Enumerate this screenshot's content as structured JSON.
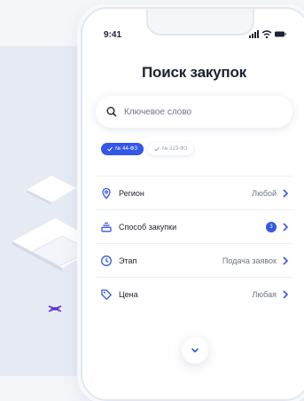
{
  "status_bar": {
    "time": "9:41"
  },
  "page_title": "Поиск закупок",
  "search": {
    "placeholder": "Ключевое слово",
    "value": ""
  },
  "chips": [
    {
      "label": "№ 44-ФЗ",
      "active": true
    },
    {
      "label": "№ 223-ФЗ",
      "active": false
    }
  ],
  "filters": [
    {
      "label": "Регион",
      "value": "Любой",
      "icon": "location-pin-icon"
    },
    {
      "label": "Способ закупки",
      "badge": "3",
      "icon": "stack-icon"
    },
    {
      "label": "Этап",
      "value": "Подача заявок",
      "icon": "clock-icon"
    },
    {
      "label": "Цена",
      "value": "Любая",
      "icon": "price-tag-icon"
    }
  ],
  "colors": {
    "accent": "#3357e6",
    "text": "#1c2230",
    "muted": "#6d7587"
  }
}
